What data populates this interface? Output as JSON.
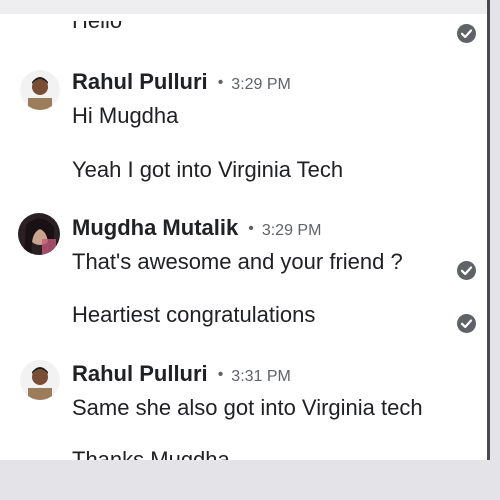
{
  "messages": {
    "top_partial": "Hello",
    "group1": {
      "sender": "Rahul Pulluri",
      "separator": "•",
      "time": "3:29 PM",
      "lines": [
        "Hi Mugdha",
        "Yeah I got into Virginia Tech"
      ]
    },
    "group2": {
      "sender": "Mugdha Mutalik",
      "separator": "•",
      "time": "3:29 PM",
      "lines": [
        "That's awesome and your friend ?",
        "Heartiest congratulations"
      ]
    },
    "group3": {
      "sender": "Rahul Pulluri",
      "separator": "•",
      "time": "3:31 PM",
      "lines": [
        "Same she also got into Virginia tech",
        "Thanks Mugdha"
      ]
    }
  },
  "icons": {
    "read_receipt": "check-circle-icon",
    "avatar_rahul": "avatar",
    "avatar_mugdha": "avatar"
  },
  "colors": {
    "text": "#202124",
    "muted": "#5f6368",
    "background": "#ffffff"
  }
}
